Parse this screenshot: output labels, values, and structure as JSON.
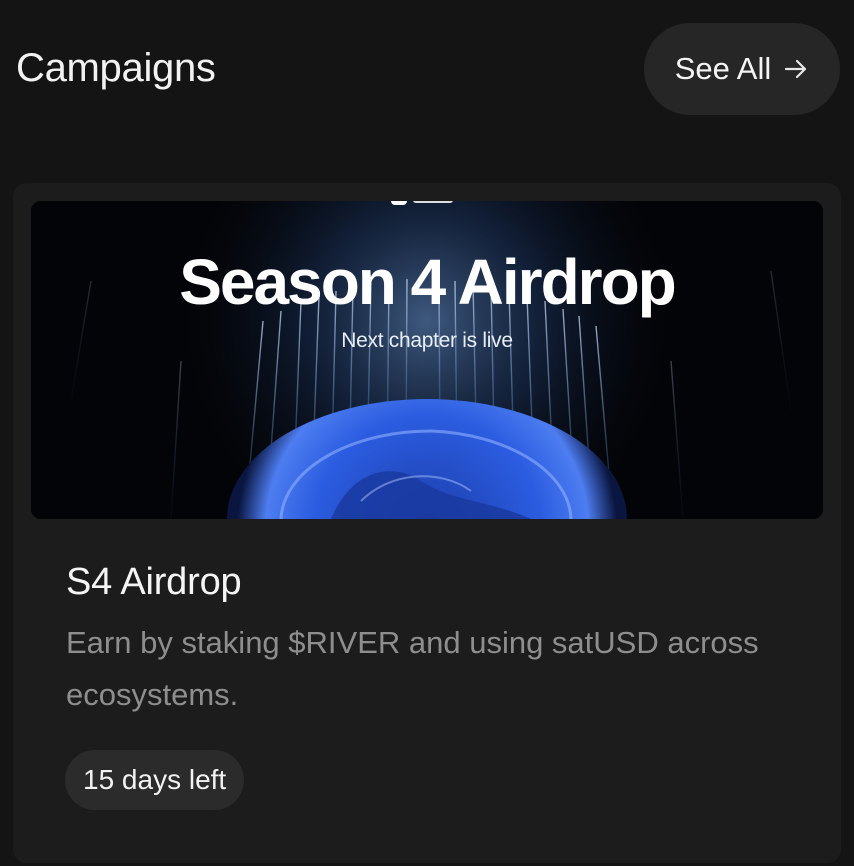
{
  "section": {
    "title": "Campaigns",
    "see_all_label": "See All",
    "see_all_icon": "arrow-right-icon"
  },
  "campaign": {
    "banner": {
      "title": "Season 4 Airdrop",
      "subtitle": "Next chapter is live",
      "logo_icon": "river-logo"
    },
    "name": "S4 Airdrop",
    "description": "Earn by staking $RIVER and using satUSD across ecosystems.",
    "time_left": "15 days left"
  },
  "colors": {
    "background": "#141414",
    "card": "#1c1c1c",
    "pill": "#262626",
    "muted_text": "#8e8e8e",
    "banner_accent": "#2f5fd8"
  }
}
